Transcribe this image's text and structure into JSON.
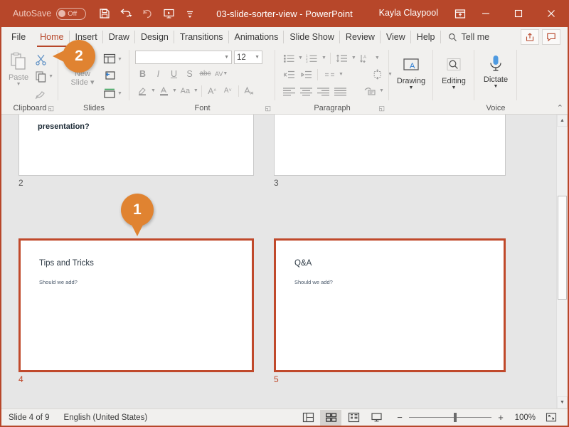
{
  "titlebar": {
    "autosave_label": "AutoSave",
    "autosave_state": "Off",
    "document_title": "03-slide-sorter-view  -  PowerPoint",
    "account_name": "Kayla Claypool",
    "qat": [
      {
        "name": "save-icon",
        "tooltip": "Save"
      },
      {
        "name": "undo-icon",
        "tooltip": "Undo"
      },
      {
        "name": "redo-icon",
        "tooltip": "Redo"
      },
      {
        "name": "start-presentation-icon",
        "tooltip": "Start From Beginning"
      },
      {
        "name": "customize-qat-icon",
        "tooltip": "Customize Quick Access Toolbar"
      }
    ],
    "window_controls": [
      "minimize",
      "maximize",
      "close"
    ],
    "brand_color": "#b7472a"
  },
  "tabs": [
    {
      "label": "File",
      "active": false
    },
    {
      "label": "Home",
      "active": true
    },
    {
      "label": "Insert",
      "active": false
    },
    {
      "label": "Draw",
      "active": false
    },
    {
      "label": "Design",
      "active": false
    },
    {
      "label": "Transitions",
      "active": false
    },
    {
      "label": "Animations",
      "active": false
    },
    {
      "label": "Slide Show",
      "active": false
    },
    {
      "label": "Review",
      "active": false
    },
    {
      "label": "View",
      "active": false
    },
    {
      "label": "Help",
      "active": false
    }
  ],
  "tellme": {
    "label": "Tell me"
  },
  "tab_right_buttons": [
    {
      "name": "share-button",
      "label": "Share"
    },
    {
      "name": "comments-button",
      "label": "Comments"
    }
  ],
  "ribbon": {
    "groups": [
      {
        "name": "clipboard",
        "label": "Clipboard",
        "launcher": true
      },
      {
        "name": "slides",
        "label": "Slides",
        "launcher": false
      },
      {
        "name": "font",
        "label": "Font",
        "launcher": true
      },
      {
        "name": "paragraph",
        "label": "Paragraph",
        "launcher": true
      },
      {
        "name": "drawing",
        "label": "",
        "launcher": false
      },
      {
        "name": "editing",
        "label": "",
        "launcher": false
      },
      {
        "name": "voice",
        "label": "Voice",
        "launcher": false
      }
    ],
    "clipboard": {
      "paste_label": "Paste",
      "cut_tooltip": "Cut",
      "copy_tooltip": "Copy",
      "format_painter_tooltip": "Format Painter"
    },
    "slides": {
      "new_slide_label": "New\nSlide",
      "new_slide_line1": "New",
      "new_slide_line2": "Slide",
      "layout_tooltip": "Layout",
      "reset_tooltip": "Reset",
      "section_tooltip": "Section"
    },
    "font": {
      "font_name_value": "",
      "font_name_placeholder": "",
      "font_size_value": "12",
      "bold": "B",
      "italic": "I",
      "underline": "U",
      "shadow": "S",
      "strikethrough": "abc",
      "character_spacing": "AV",
      "text_highlight_tooltip": "Text Highlight Color",
      "font_color_tooltip": "Font Color",
      "change_case": "Aa",
      "increase_size": "A",
      "decrease_size": "A",
      "clear_formatting_tooltip": "Clear All Formatting"
    },
    "drawing": {
      "label": "Drawing"
    },
    "editing": {
      "label": "Editing"
    },
    "dictate": {
      "label": "Dictate"
    },
    "collapse_tooltip": "Collapse the Ribbon"
  },
  "sorter": {
    "slides": [
      {
        "number": "2",
        "title": "presentation?",
        "title_style": "bold-cut",
        "body": "",
        "selected": false
      },
      {
        "number": "3",
        "title": "",
        "body": "",
        "selected": false
      },
      {
        "number": "4",
        "title": "Tips and Tricks",
        "body": "Should we add?",
        "selected": true
      },
      {
        "number": "5",
        "title": "Q&A",
        "body": "Should we add?",
        "selected": true
      }
    ],
    "selection_color": "#c0492b"
  },
  "statusbar": {
    "slide_indicator": "Slide 4 of 9",
    "language": "English (United States)",
    "views": [
      {
        "name": "normal-view-button",
        "label": "Normal",
        "active": false
      },
      {
        "name": "slide-sorter-view-button",
        "label": "Slide Sorter",
        "active": true
      },
      {
        "name": "reading-view-button",
        "label": "Reading View",
        "active": false
      },
      {
        "name": "slide-show-button",
        "label": "Slide Show",
        "active": false
      }
    ],
    "zoom_out": "−",
    "zoom_in": "+",
    "zoom_level": "100%",
    "fit_tooltip": "Fit slide to current window"
  },
  "callouts": [
    {
      "number": "1",
      "direction": "down",
      "target": "slide-4-thumbnail"
    },
    {
      "number": "2",
      "direction": "left",
      "target": "cut-button"
    }
  ]
}
